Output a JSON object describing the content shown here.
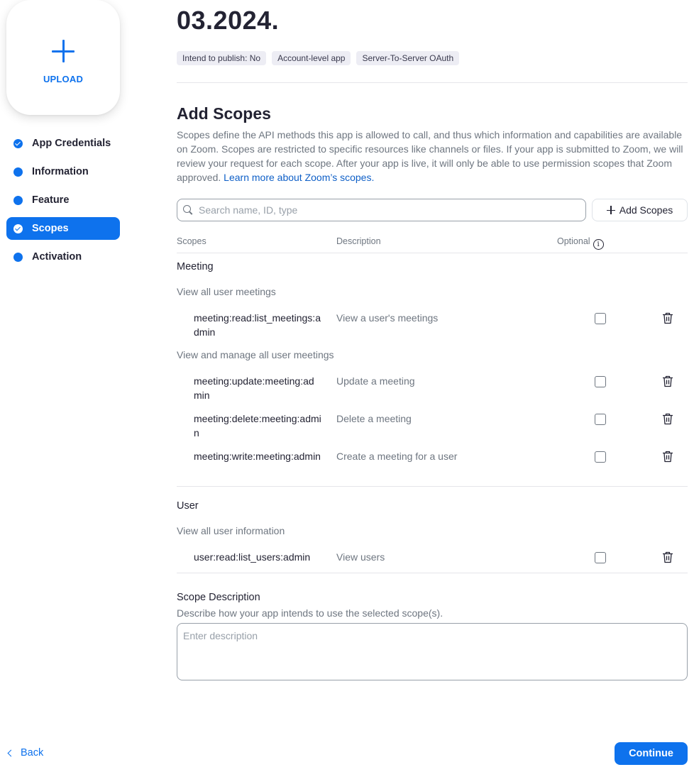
{
  "upload": {
    "label": "UPLOAD"
  },
  "sidebar": {
    "items": [
      {
        "label": "App Credentials",
        "state": "done"
      },
      {
        "label": "Information",
        "state": "pending"
      },
      {
        "label": "Feature",
        "state": "pending"
      },
      {
        "label": "Scopes",
        "state": "active"
      },
      {
        "label": "Activation",
        "state": "pending"
      }
    ]
  },
  "header": {
    "date": "03.2024.",
    "tags": [
      "Intend to publish: No",
      "Account-level app",
      "Server-To-Server OAuth"
    ]
  },
  "scopes": {
    "title": "Add Scopes",
    "intro": "Scopes define the API methods this app is allowed to call, and thus which information and capabilities are available on Zoom. Scopes are restricted to specific resources like channels or files. If your app is submitted to Zoom, we will review your request for each scope. After your app is live, it will only be able to use permission scopes that Zoom approved. ",
    "learn_more": "Learn more about Zoom’s scopes.",
    "search_placeholder": "Search name, ID, type",
    "add_button": "Add Scopes",
    "columns": {
      "scopes": "Scopes",
      "description": "Description",
      "optional": "Optional",
      "info": "i"
    },
    "groups": [
      {
        "title": "Meeting",
        "subgroups": [
          {
            "title": "View all user meetings",
            "rows": [
              {
                "name": "meeting:read:list_meetings:admin",
                "description": "View a user's meetings",
                "optional": false
              }
            ]
          },
          {
            "title": "View and manage all user meetings",
            "rows": [
              {
                "name": "meeting:update:meeting:admin",
                "description": "Update a meeting",
                "optional": false
              },
              {
                "name": "meeting:delete:meeting:admin",
                "description": "Delete a meeting",
                "optional": false
              },
              {
                "name": "meeting:write:meeting:admin",
                "description": "Create a meeting for a user",
                "optional": false
              }
            ]
          }
        ]
      },
      {
        "title": "User",
        "subgroups": [
          {
            "title": "View all user information",
            "rows": [
              {
                "name": "user:read:list_users:admin",
                "description": "View users",
                "optional": false
              }
            ]
          }
        ]
      }
    ]
  },
  "scope_description": {
    "label": "Scope Description",
    "hint": "Describe how your app intends to use the selected scope(s).",
    "placeholder": "Enter description"
  },
  "footer": {
    "back": "Back",
    "continue": "Continue"
  },
  "colors": {
    "accent": "#0e72ed",
    "text": "#232333",
    "muted": "#6e7680",
    "tag_bg": "#ededf4"
  }
}
